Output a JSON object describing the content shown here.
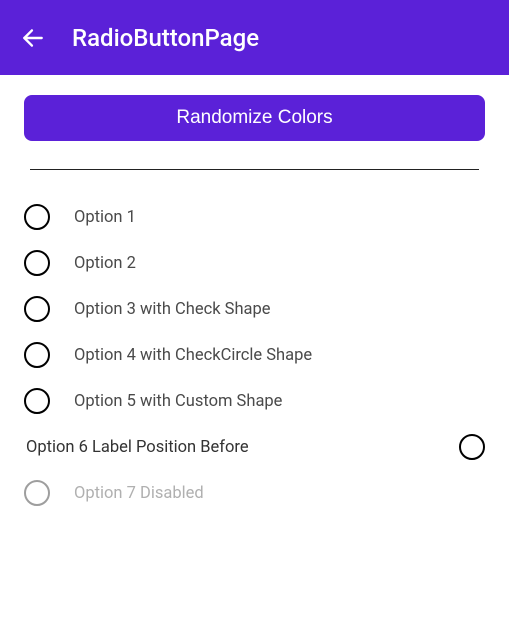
{
  "appbar": {
    "title": "RadioButtonPage"
  },
  "actions": {
    "randomize_label": "Randomize Colors"
  },
  "options": [
    {
      "label": "Option 1",
      "label_position": "after",
      "disabled": false
    },
    {
      "label": "Option 2",
      "label_position": "after",
      "disabled": false
    },
    {
      "label": "Option 3 with Check Shape",
      "label_position": "after",
      "disabled": false
    },
    {
      "label": "Option 4 with CheckCircle Shape",
      "label_position": "after",
      "disabled": false
    },
    {
      "label": "Option 5 with Custom Shape",
      "label_position": "after",
      "disabled": false
    },
    {
      "label": "Option 6 Label Position Before",
      "label_position": "before",
      "disabled": false
    },
    {
      "label": "Option 7 Disabled",
      "label_position": "after",
      "disabled": true
    }
  ]
}
